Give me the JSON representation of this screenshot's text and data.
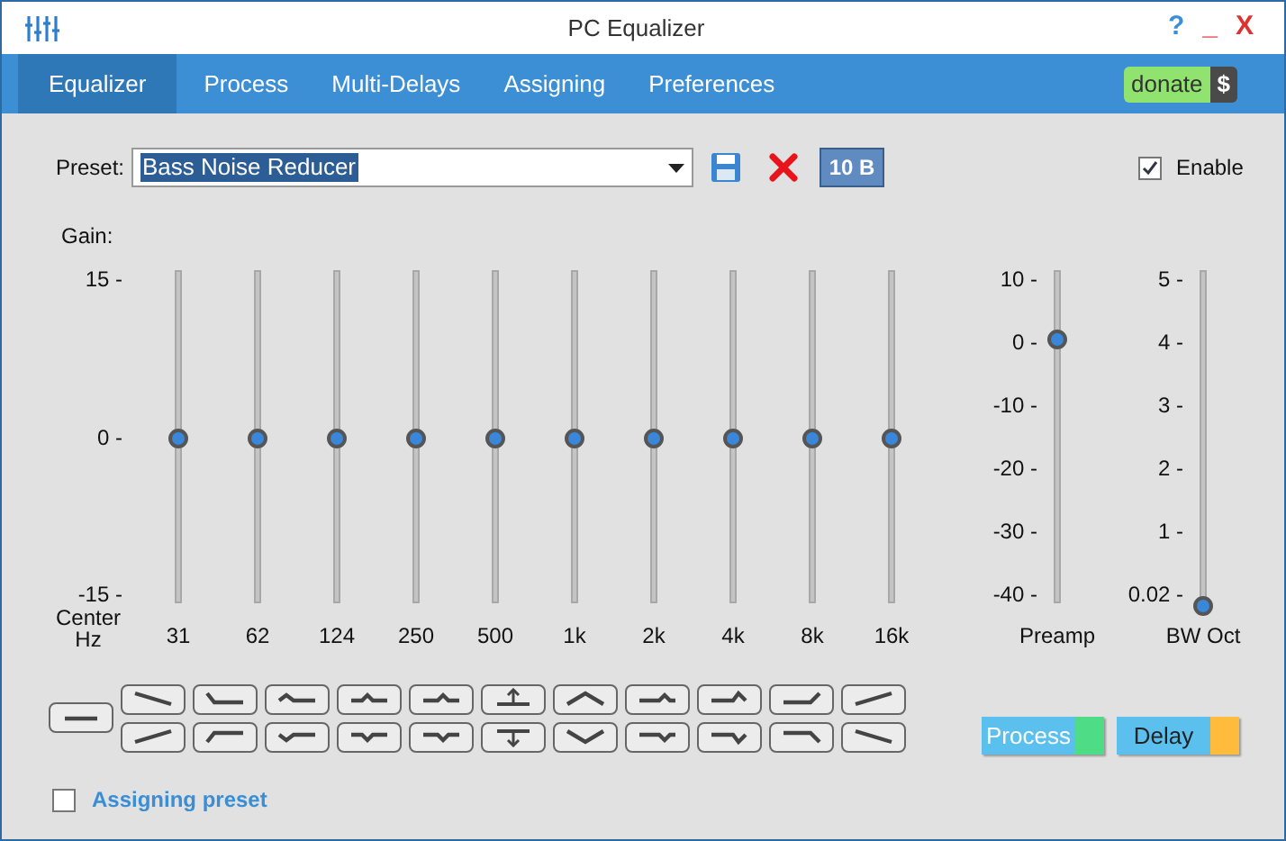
{
  "window": {
    "title": "PC Equalizer",
    "help": "?",
    "minimize": "_",
    "close": "X"
  },
  "tabs": [
    {
      "label": "Equalizer",
      "selected": true
    },
    {
      "label": "Process",
      "selected": false
    },
    {
      "label": "Multi-Delays",
      "selected": false
    },
    {
      "label": "Assigning",
      "selected": false
    },
    {
      "label": "Preferences",
      "selected": false
    }
  ],
  "donate": {
    "label": "donate",
    "symbol": "$"
  },
  "preset": {
    "label": "Preset:",
    "value": "Bass Noise Reducer",
    "bands_button": "10 B"
  },
  "enable": {
    "label": "Enable",
    "checked": true
  },
  "gain": {
    "label": "Gain:",
    "ticks": [
      "15 -",
      "0 -",
      "-15 -"
    ],
    "axis_label": [
      "Center",
      "Hz"
    ]
  },
  "bands": [
    {
      "label": "31",
      "level": 0.5
    },
    {
      "label": "62",
      "level": 0.5
    },
    {
      "label": "124",
      "level": 0.5
    },
    {
      "label": "250",
      "level": 0.5
    },
    {
      "label": "500",
      "level": 0.5
    },
    {
      "label": "1k",
      "level": 0.5
    },
    {
      "label": "2k",
      "level": 0.5
    },
    {
      "label": "4k",
      "level": 0.5
    },
    {
      "label": "8k",
      "level": 0.5
    },
    {
      "label": "16k",
      "level": 0.5
    }
  ],
  "preamp": {
    "label": "Preamp",
    "ticks": [
      "10 -",
      "0 -",
      "-10 -",
      "-20 -",
      "-30 -",
      "-40 -"
    ],
    "level": 0.8
  },
  "bandwidth": {
    "label": "BW Oct",
    "ticks": [
      "5 -",
      "4 -",
      "3 -",
      "2 -",
      "1 -",
      "0.02 -"
    ],
    "level": 0
  },
  "action_buttons": [
    {
      "label": "Process",
      "color": "#4fdc86"
    },
    {
      "label": "Delay",
      "color": "#ffbb3c"
    }
  ],
  "assigning_preset": {
    "label": "Assigning preset",
    "checked": false
  }
}
